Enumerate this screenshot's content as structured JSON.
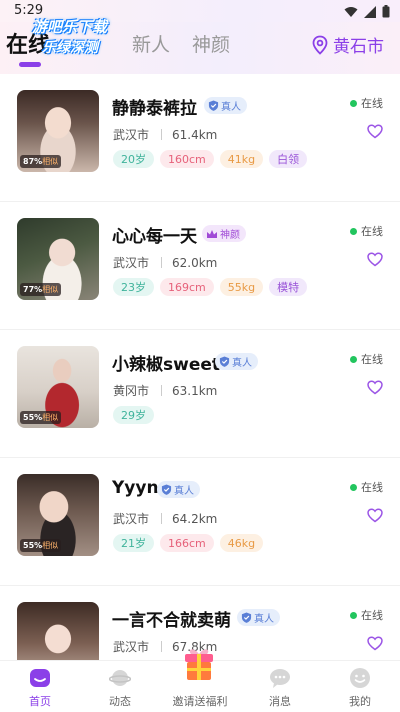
{
  "status_bar": {
    "time": "5:29"
  },
  "header": {
    "tabs": [
      "在线",
      "新人",
      "神颜"
    ],
    "watermark_lines": [
      "游吧乐下载",
      "乐绿深测"
    ],
    "location": "黄石市"
  },
  "cards": [
    {
      "name": "静静泰裤拉",
      "badge": "真人",
      "badge_type": "real",
      "city": "武汉市",
      "distance": "61.4km",
      "similarity_pct": "87%",
      "similarity_label": "相似",
      "status": "在线",
      "tags": [
        {
          "type": "age",
          "text": "20岁"
        },
        {
          "type": "height",
          "text": "160cm"
        },
        {
          "type": "weight",
          "text": "41kg"
        },
        {
          "type": "job",
          "text": "白领"
        }
      ]
    },
    {
      "name": "心心每一天",
      "badge": "神颜",
      "badge_type": "god",
      "city": "武汉市",
      "distance": "62.0km",
      "similarity_pct": "77%",
      "similarity_label": "相似",
      "status": "在线",
      "tags": [
        {
          "type": "age",
          "text": "23岁"
        },
        {
          "type": "height",
          "text": "169cm"
        },
        {
          "type": "weight",
          "text": "55kg"
        },
        {
          "type": "job",
          "text": "模特"
        }
      ]
    },
    {
      "name": "小辣椒sweet",
      "badge": "真人",
      "badge_type": "real",
      "city": "黄冈市",
      "distance": "63.1km",
      "similarity_pct": "55%",
      "similarity_label": "相似",
      "status": "在线",
      "tags": [
        {
          "type": "age",
          "text": "29岁"
        }
      ]
    },
    {
      "name": "Yyyn",
      "badge": "真人",
      "badge_type": "real",
      "city": "武汉市",
      "distance": "64.2km",
      "similarity_pct": "55%",
      "similarity_label": "相似",
      "status": "在线",
      "tags": [
        {
          "type": "age",
          "text": "21岁"
        },
        {
          "type": "height",
          "text": "166cm"
        },
        {
          "type": "weight",
          "text": "46kg"
        }
      ]
    },
    {
      "name": "一言不合就卖萌",
      "badge": "真人",
      "badge_type": "real",
      "city": "武汉市",
      "distance": "67.8km",
      "similarity_pct": "",
      "similarity_label": "",
      "status": "在线",
      "tags": []
    }
  ],
  "bottom_nav": [
    {
      "label": "首页",
      "icon": "home-icon",
      "active": true
    },
    {
      "label": "动态",
      "icon": "planet-icon",
      "active": false
    },
    {
      "label": "邀请送福利",
      "icon": "gift-icon",
      "active": false
    },
    {
      "label": "消息",
      "icon": "chat-icon",
      "active": false
    },
    {
      "label": "我的",
      "icon": "smile-icon",
      "active": false
    }
  ],
  "colors": {
    "accent": "#8b3fe8",
    "online": "#22c55e"
  }
}
